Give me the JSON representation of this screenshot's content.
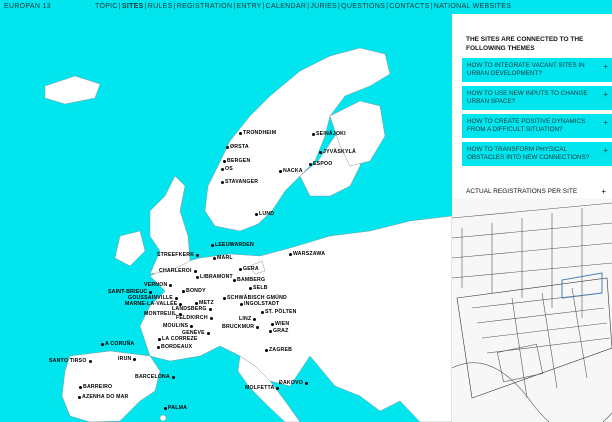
{
  "brand": "EUROPAN 13",
  "nav": [
    {
      "label": "TOPIC",
      "active": false
    },
    {
      "label": "SITES",
      "active": true
    },
    {
      "label": "RULES",
      "active": false
    },
    {
      "label": "REGISTRATION",
      "active": false
    },
    {
      "label": "ENTRY",
      "active": false
    },
    {
      "label": "CALENDAR",
      "active": false
    },
    {
      "label": "JURIES",
      "active": false
    },
    {
      "label": "QUESTIONS",
      "active": false
    },
    {
      "label": "CONTACTS",
      "active": false
    },
    {
      "label": "NATIONAL WEBSITES",
      "active": false
    }
  ],
  "panel": {
    "title": "THE SITES ARE CONNECTED TO THE FOLLOWING THEMES",
    "themes": [
      "HOW TO INTEGRATE VACANT SITES IN URBAN DEVELOPMENT?",
      "HOW TO USE NEW INPUTS TO CHANGE URBAN SPACE?",
      "HOW TO CREATE POSITIVE DYNAMICS FROM A DIFFICULT SITUATION?",
      "HOW TO TRANSFORM PHYSICAL OBSTACLES INTO NEW CONNECTIONS?"
    ],
    "plus": "+",
    "registrations_label": "ACTUAL REGISTRATIONS PER SITE"
  },
  "cities": [
    "TRONDHEIM",
    "ØRSTA",
    "BERGEN",
    "OS",
    "STAVANGER",
    "SEINÄJOKI",
    "JYVÄSKYLÄ",
    "ESPOO",
    "NACKA",
    "LUND",
    "LEEUWARDEN",
    "STREEFKERK",
    "MARL",
    "GERA",
    "WARSZAWA",
    "CHARLEROI",
    "LIBRAMONT",
    "BAMBERG",
    "SELB",
    "VERNON",
    "BONDY",
    "SAINT-BRIEUC",
    "GOUSSAINVILLE",
    "MARNE-LA-VALLÉE",
    "METZ",
    "SCHWÄBISCH GMÜND",
    "LANDSBERG",
    "INGOLSTADT",
    "MONTREUIL",
    "ST. PÖLTEN",
    "FELDKIRCH",
    "LINZ",
    "WIEN",
    "MOULINS",
    "BRUCKMUR",
    "GRAZ",
    "GENÈVE",
    "LA CORREZE",
    "A CORUÑA",
    "BORDEAUX",
    "ZAGREB",
    "IRUN",
    "SANTO TIRSO",
    "BARCELONA",
    "ĐAKOVO",
    "BARREIRO",
    "AZENHA DO MAR",
    "MOLFETTA",
    "PALMA"
  ]
}
